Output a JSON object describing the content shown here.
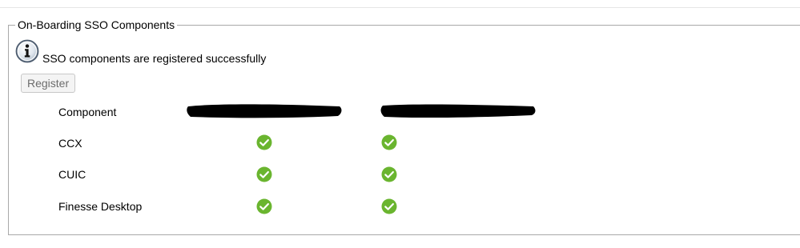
{
  "section": {
    "legend": "On-Boarding SSO Components"
  },
  "status": {
    "icon": "info-icon",
    "message": "SSO components are registered successfully"
  },
  "actions": {
    "register_label": "Register"
  },
  "table": {
    "header_label": "Component",
    "columns": [
      "redacted",
      "redacted"
    ],
    "rows": [
      {
        "label": "CCX",
        "status": [
          "success",
          "success"
        ]
      },
      {
        "label": "CUIC",
        "status": [
          "success",
          "success"
        ]
      },
      {
        "label": "Finesse Desktop",
        "status": [
          "success",
          "success"
        ]
      }
    ]
  },
  "colors": {
    "success": "#6ab52f",
    "border": "#a9a9a9",
    "redaction": "#000000"
  }
}
